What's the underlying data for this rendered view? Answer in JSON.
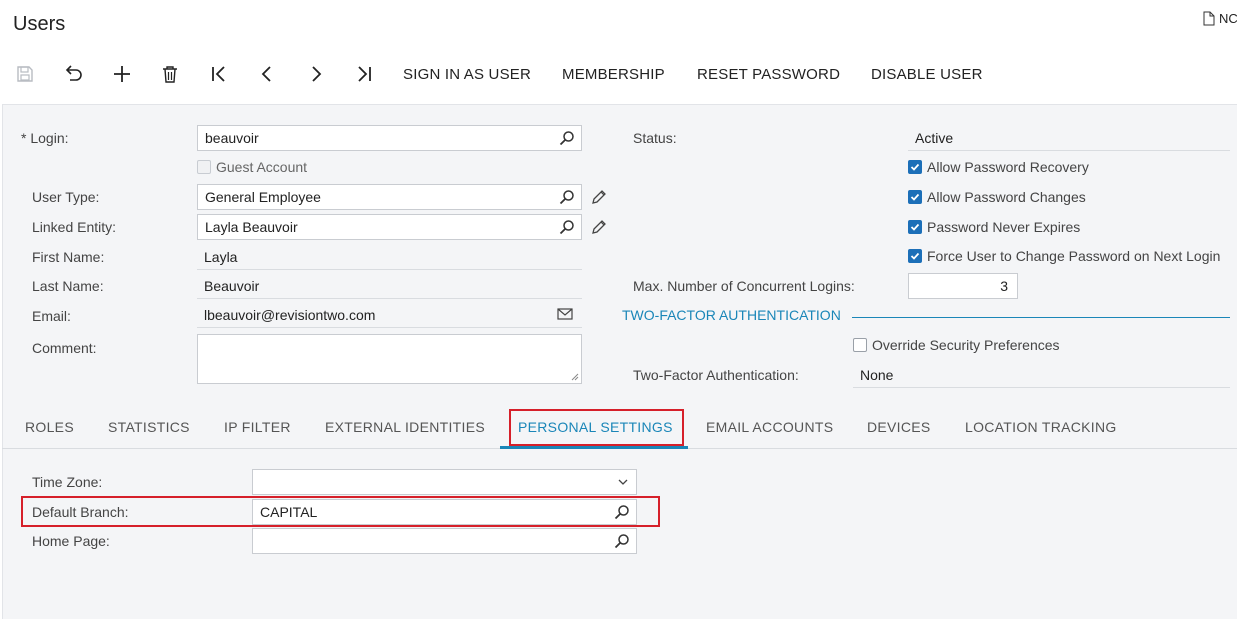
{
  "header": {
    "title": "Users",
    "notes_label": "NC"
  },
  "toolbar": {
    "icons": [
      "save-icon",
      "undo-icon",
      "add-icon",
      "delete-icon",
      "first-icon",
      "previous-icon",
      "next-icon",
      "last-icon"
    ],
    "sign_in_as_user": "SIGN IN AS USER",
    "membership": "MEMBERSHIP",
    "reset_password": "RESET PASSWORD",
    "disable_user": "DISABLE USER"
  },
  "form": {
    "required_mark": "*",
    "login": {
      "label": "Login:",
      "value": "beauvoir"
    },
    "guest_account": {
      "label": "Guest Account",
      "checked": false
    },
    "user_type": {
      "label": "User Type:",
      "value": "General Employee"
    },
    "linked_entity": {
      "label": "Linked Entity:",
      "value": "Layla Beauvoir"
    },
    "first_name": {
      "label": "First Name:",
      "value": "Layla"
    },
    "last_name": {
      "label": "Last Name:",
      "value": "Beauvoir"
    },
    "email": {
      "label": "Email:",
      "value": "lbeauvoir@revisiontwo.com"
    },
    "comment": {
      "label": "Comment:",
      "value": ""
    },
    "status": {
      "label": "Status:",
      "value": "Active"
    },
    "allow_password_recovery": {
      "label": "Allow Password Recovery",
      "checked": true
    },
    "allow_password_changes": {
      "label": "Allow Password Changes",
      "checked": true
    },
    "password_never_expires": {
      "label": "Password Never Expires",
      "checked": true
    },
    "force_change_password": {
      "label": "Force User to Change Password on Next Login",
      "checked": true
    },
    "max_concurrent_logins": {
      "label": "Max. Number of Concurrent Logins:",
      "value": "3"
    },
    "two_factor_section": "TWO-FACTOR AUTHENTICATION",
    "override_security": {
      "label": "Override Security Preferences",
      "checked": false
    },
    "two_factor_auth": {
      "label": "Two-Factor Authentication:",
      "value": "None"
    }
  },
  "tabs": [
    {
      "label": "ROLES"
    },
    {
      "label": "STATISTICS"
    },
    {
      "label": "IP FILTER"
    },
    {
      "label": "EXTERNAL IDENTITIES"
    },
    {
      "label": "PERSONAL SETTINGS",
      "active": true
    },
    {
      "label": "EMAIL ACCOUNTS"
    },
    {
      "label": "DEVICES"
    },
    {
      "label": "LOCATION TRACKING"
    }
  ],
  "personal_settings": {
    "time_zone": {
      "label": "Time Zone:",
      "value": ""
    },
    "default_branch": {
      "label": "Default Branch:",
      "value": "CAPITAL"
    },
    "home_page": {
      "label": "Home Page:",
      "value": ""
    }
  },
  "colors": {
    "accent": "#1a86b8",
    "highlight": "#d6202a",
    "checkbox": "#1c6fb8"
  }
}
